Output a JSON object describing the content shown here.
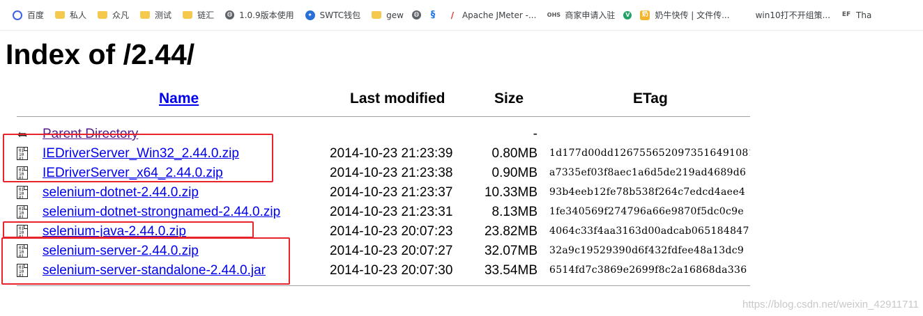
{
  "bookmarks": [
    {
      "icon": "baidu-icon",
      "label": "百度"
    },
    {
      "icon": "folder-icon",
      "label": "私人"
    },
    {
      "icon": "folder-icon",
      "label": "众凡"
    },
    {
      "icon": "folder-icon",
      "label": "测试"
    },
    {
      "icon": "folder-icon",
      "label": "链汇"
    },
    {
      "icon": "globe-icon",
      "label": "1.0.9版本使用"
    },
    {
      "icon": "swtc-icon",
      "label": "SWTC钱包"
    },
    {
      "icon": "folder-icon",
      "label": "gew"
    },
    {
      "icon": "globe-icon",
      "label": ""
    },
    {
      "icon": "s-logo-icon",
      "label": ""
    },
    {
      "icon": "jmeter-icon",
      "label": "Apache JMeter -..."
    },
    {
      "icon": "ohs-icon",
      "label": "商家申请入驻"
    },
    {
      "icon": "green-v-icon",
      "label": ""
    },
    {
      "icon": "cow-icon",
      "label": "奶牛快传 | 文件传..."
    },
    {
      "icon": "windows-icon",
      "label": "win10打不开组策..."
    },
    {
      "icon": "ef-icon",
      "label": "Tha"
    }
  ],
  "page": {
    "title": "Index of /2.44/"
  },
  "table": {
    "headers": {
      "name": "Name",
      "last_modified": "Last modified",
      "size": "Size",
      "etag": "ETag"
    },
    "parent": {
      "label": "Parent Directory",
      "size": "-"
    },
    "rows": [
      {
        "name": "IEDriverServer_Win32_2.44.0.zip",
        "date": "2014-10-23 21:23:39",
        "size": "0.80MB",
        "etag": "1d177d00dd1267556520973516491081"
      },
      {
        "name": "IEDriverServer_x64_2.44.0.zip",
        "date": "2014-10-23 21:23:38",
        "size": "0.90MB",
        "etag": "a7335ef03f8aec1a6d5de219ad4689d6"
      },
      {
        "name": "selenium-dotnet-2.44.0.zip",
        "date": "2014-10-23 21:23:37",
        "size": "10.33MB",
        "etag": "93b4eeb12fe78b538f264c7edcd4aee4"
      },
      {
        "name": "selenium-dotnet-strongnamed-2.44.0.zip",
        "date": "2014-10-23 21:23:31",
        "size": "8.13MB",
        "etag": "1fe340569f274796a66e9870f5dc0c9e"
      },
      {
        "name": "selenium-java-2.44.0.zip",
        "date": "2014-10-23 20:07:23",
        "size": "23.82MB",
        "etag": "4064c33f4aa3163d00adcab065184847"
      },
      {
        "name": "selenium-server-2.44.0.zip",
        "date": "2014-10-23 20:07:27",
        "size": "32.07MB",
        "etag": "32a9c19529390d6f432fdfee48a13dc9"
      },
      {
        "name": "selenium-server-standalone-2.44.0.jar",
        "date": "2014-10-23 20:07:30",
        "size": "33.54MB",
        "etag": "6514fd7c3869e2699f8c2a16868da336"
      }
    ]
  },
  "annotation_color": "#e8232a",
  "watermark": "https://blog.csdn.net/weixin_42911711"
}
